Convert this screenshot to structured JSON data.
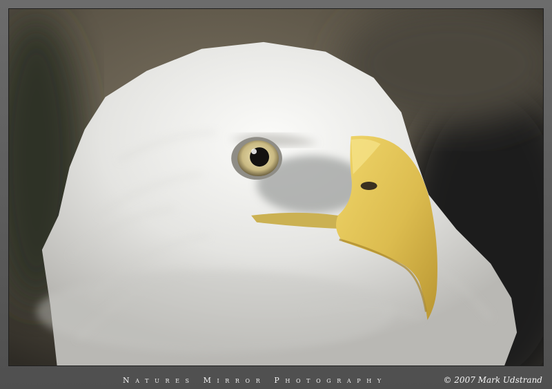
{
  "image": {
    "subject": "bald-eagle-head-portrait",
    "colors": {
      "background_blur": "#6f6454",
      "feathers": "#e7e7e4",
      "beak": "#e3c65b",
      "eye_iris": "#d2c491",
      "frame": "#5e5e5e"
    }
  },
  "caption": {
    "studio": "Natures Mirror Photography",
    "copyright": "© 2007 Mark Udstrand"
  }
}
